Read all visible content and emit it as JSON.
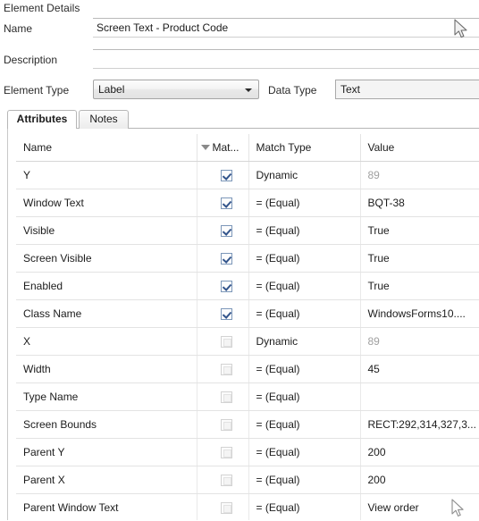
{
  "panel": {
    "title": "Element Details"
  },
  "form": {
    "name_label": "Name",
    "name_value": "Screen Text - Product Code",
    "description_label": "Description",
    "description_value": "",
    "element_type_label": "Element Type",
    "element_type_value": "Label",
    "data_type_label": "Data Type",
    "data_type_value": "Text"
  },
  "tabs": [
    {
      "label": "Attributes",
      "active": true
    },
    {
      "label": "Notes",
      "active": false
    }
  ],
  "grid": {
    "columns": [
      "Name",
      "Mat...",
      "Match Type",
      "Value"
    ],
    "rows": [
      {
        "name": "Y",
        "match": true,
        "match_type": "Dynamic",
        "value": "89",
        "value_dim": true
      },
      {
        "name": "Window Text",
        "match": true,
        "match_type": "=  (Equal)",
        "value": "BQT-38",
        "value_dim": false
      },
      {
        "name": "Visible",
        "match": true,
        "match_type": "=  (Equal)",
        "value": "True",
        "value_dim": false
      },
      {
        "name": "Screen Visible",
        "match": true,
        "match_type": "=  (Equal)",
        "value": "True",
        "value_dim": false
      },
      {
        "name": "Enabled",
        "match": true,
        "match_type": "=  (Equal)",
        "value": "True",
        "value_dim": false
      },
      {
        "name": "Class Name",
        "match": true,
        "match_type": "=  (Equal)",
        "value": "WindowsForms10....",
        "value_dim": false
      },
      {
        "name": "X",
        "match": false,
        "match_type": "Dynamic",
        "value": "89",
        "value_dim": true
      },
      {
        "name": "Width",
        "match": false,
        "match_type": "=  (Equal)",
        "value": "45",
        "value_dim": false
      },
      {
        "name": "Type Name",
        "match": false,
        "match_type": "=  (Equal)",
        "value": "",
        "value_dim": false
      },
      {
        "name": "Screen Bounds",
        "match": false,
        "match_type": "=  (Equal)",
        "value": "RECT:292,314,327,3...",
        "value_dim": false
      },
      {
        "name": "Parent Y",
        "match": false,
        "match_type": "=  (Equal)",
        "value": "200",
        "value_dim": false
      },
      {
        "name": "Parent X",
        "match": false,
        "match_type": "=  (Equal)",
        "value": "200",
        "value_dim": false
      },
      {
        "name": "Parent Window Text",
        "match": false,
        "match_type": "=  (Equal)",
        "value": "View order",
        "value_dim": false
      }
    ]
  },
  "icons": {
    "filter": "filter-funnel-icon",
    "dropdown": "chevron-down-icon",
    "cursor": "mouse-pointer-icon"
  }
}
